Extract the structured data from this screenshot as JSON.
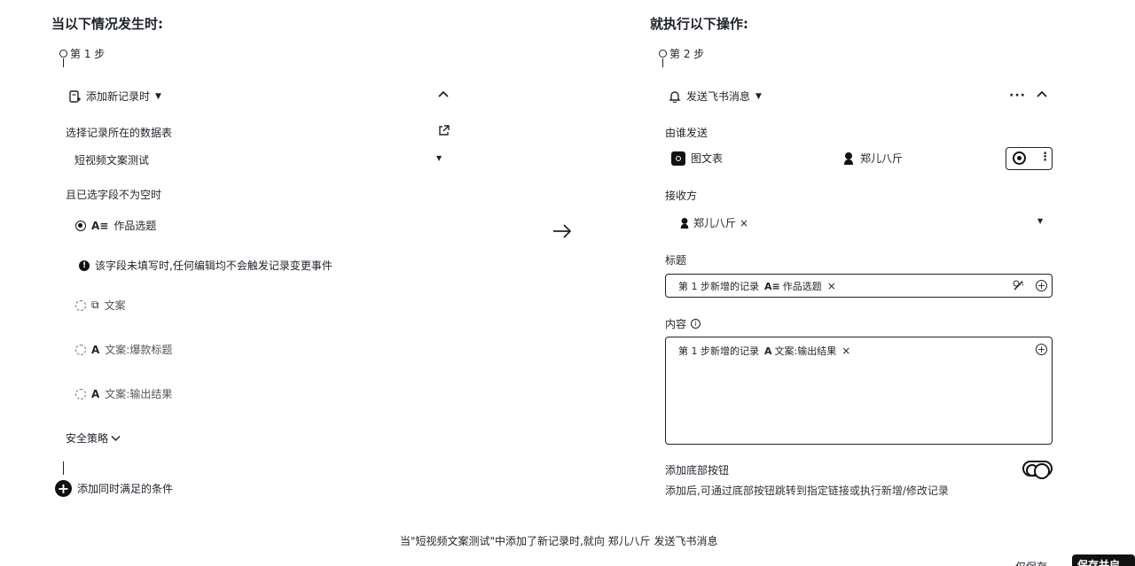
{
  "left": {
    "heading": "当以下情况发生时:",
    "step_label": "第 1 步",
    "trigger": {
      "label": "添加新记录时"
    },
    "table_section": {
      "label": "选择记录所在的数据表",
      "selected_table": "短视频文案测试"
    },
    "field_section": {
      "label": "且已选字段不为空时",
      "fields": [
        {
          "icon": "A≡",
          "name": "作品选题",
          "checked": true
        },
        {
          "icon": "⧉",
          "name": "文案",
          "checked": false
        },
        {
          "icon": "A",
          "name": "文案:爆款标题",
          "checked": false
        },
        {
          "icon": "A",
          "name": "文案:输出结果",
          "checked": false
        }
      ],
      "warning": "该字段未填写时,任何编辑均不会触发记录变更事件"
    },
    "security_label": "安全策略",
    "add_condition_label": "添加同时满足的条件"
  },
  "right": {
    "heading": "就执行以下操作:",
    "step_label": "第 2 步",
    "action": {
      "label": "发送飞书消息"
    },
    "sender": {
      "label": "由谁发送",
      "option_bot": "图文表",
      "option_user": "郑儿八斤"
    },
    "receiver": {
      "label": "接收方",
      "tag": "郑儿八斤"
    },
    "title": {
      "label": "标题",
      "prefix": "第 1 步新增的记录",
      "field_icon": "A≡",
      "field": "作品选题"
    },
    "content": {
      "label": "内容",
      "prefix": "第 1 步新增的记录",
      "field_icon": "A",
      "field": "文案:输出结果"
    },
    "bottom_button": {
      "label": "添加底部按钮",
      "desc": "添加后,可通过底部按钮跳转到指定链接或执行新增/修改记录"
    }
  },
  "summary": {
    "text": "当\"短视频文案测试\"中添加了新记录时,就向 郑儿八斤 发送飞书消息"
  },
  "footer": {
    "save_label": "仅保存",
    "save_enable_label": "保存并启用"
  }
}
